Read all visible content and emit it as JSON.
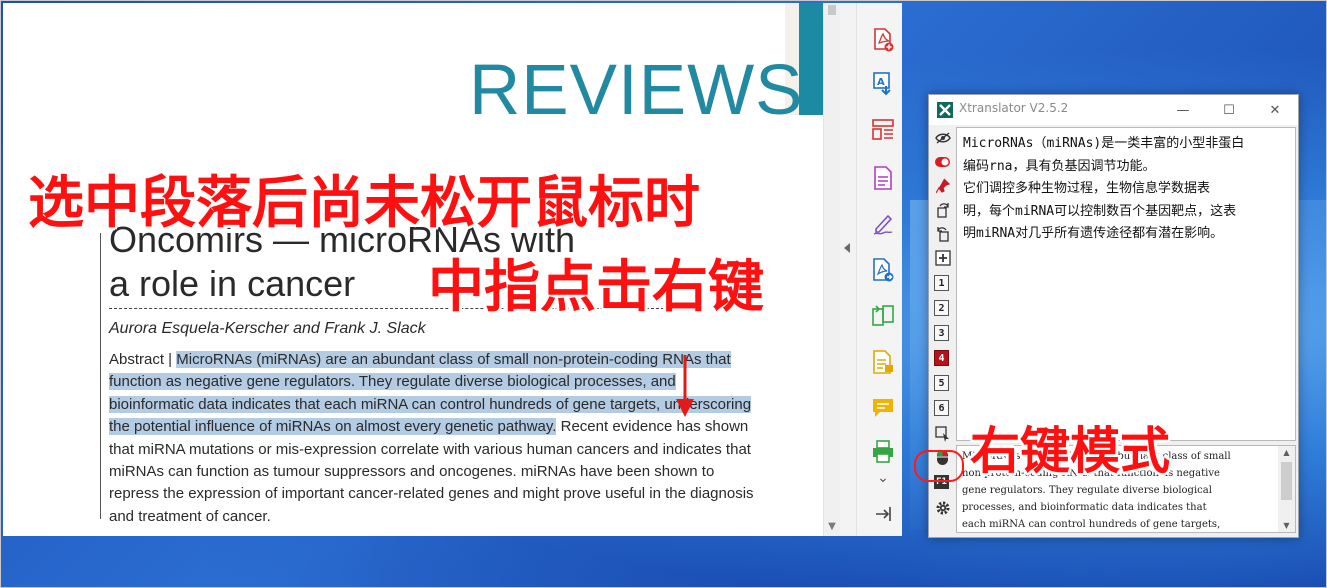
{
  "pdf": {
    "section_label": "REVIEWS",
    "article_title": "Oncomirs — microRNAs with\na role in cancer",
    "authors": "Aurora Esquela-Kerscher and Frank J. Slack",
    "abstract_label": "Abstract | ",
    "abstract_selected": "MicroRNAs (miRNAs) are an abundant class of small non-protein-coding RNAs that function as negative gene regulators. They regulate diverse biological processes, and bioinformatic data indicates that each miRNA can control hundreds of gene targets, underscoring the potential influence of miRNAs on almost every genetic pathway.",
    "abstract_rest": " Recent evidence has shown that miRNA mutations or mis-expression correlate with various human cancers and indicates that miRNAs can function as tumour suppressors and oncogenes. miRNAs have been shown to repress the expression of important cancer-related genes and might prove useful in the diagnosis and treatment of cancer."
  },
  "annotations": {
    "line1": "选中段落后尚未松开鼠标时",
    "line2": "中指点击右键",
    "mode_label": "右键模式"
  },
  "toolbar_icons": [
    "pdf-add-icon",
    "translate-page-icon",
    "layout-icon",
    "pdf-text-icon",
    "sign-icon",
    "pdf-convert-icon",
    "compare-icon",
    "note-page-icon",
    "comment-icon",
    "print-icon",
    "chevron-down-icon",
    "exit-arrow-icon"
  ],
  "xtranslator": {
    "title": "Xtranslator V2.5.2",
    "output_lines": [
      "MicroRNAs（miRNAs)是一类丰富的小型非蛋白",
      "编码rna，具有负基因调节功能。",
      "它们调控多种生物过程，生物信息学数据表",
      "明，每个miRNA可以控制数百个基因靶点，这表",
      "明miRNA对几乎所有遗传途径都有潜在影响。"
    ],
    "input_lines": [
      "MicroRNAs (miRNAs) are an abundant class of small",
      "non-protein-coding RNAs that function as negative",
      "gene regulators. They regulate diverse biological",
      "processes, and bioinformatic data indicates that",
      "each miRNA can control hundreds of gene targets,"
    ],
    "number_buttons": [
      "1",
      "2",
      "3",
      "4",
      "5",
      "6"
    ],
    "active_number": "4",
    "f1_label": "F1"
  }
}
